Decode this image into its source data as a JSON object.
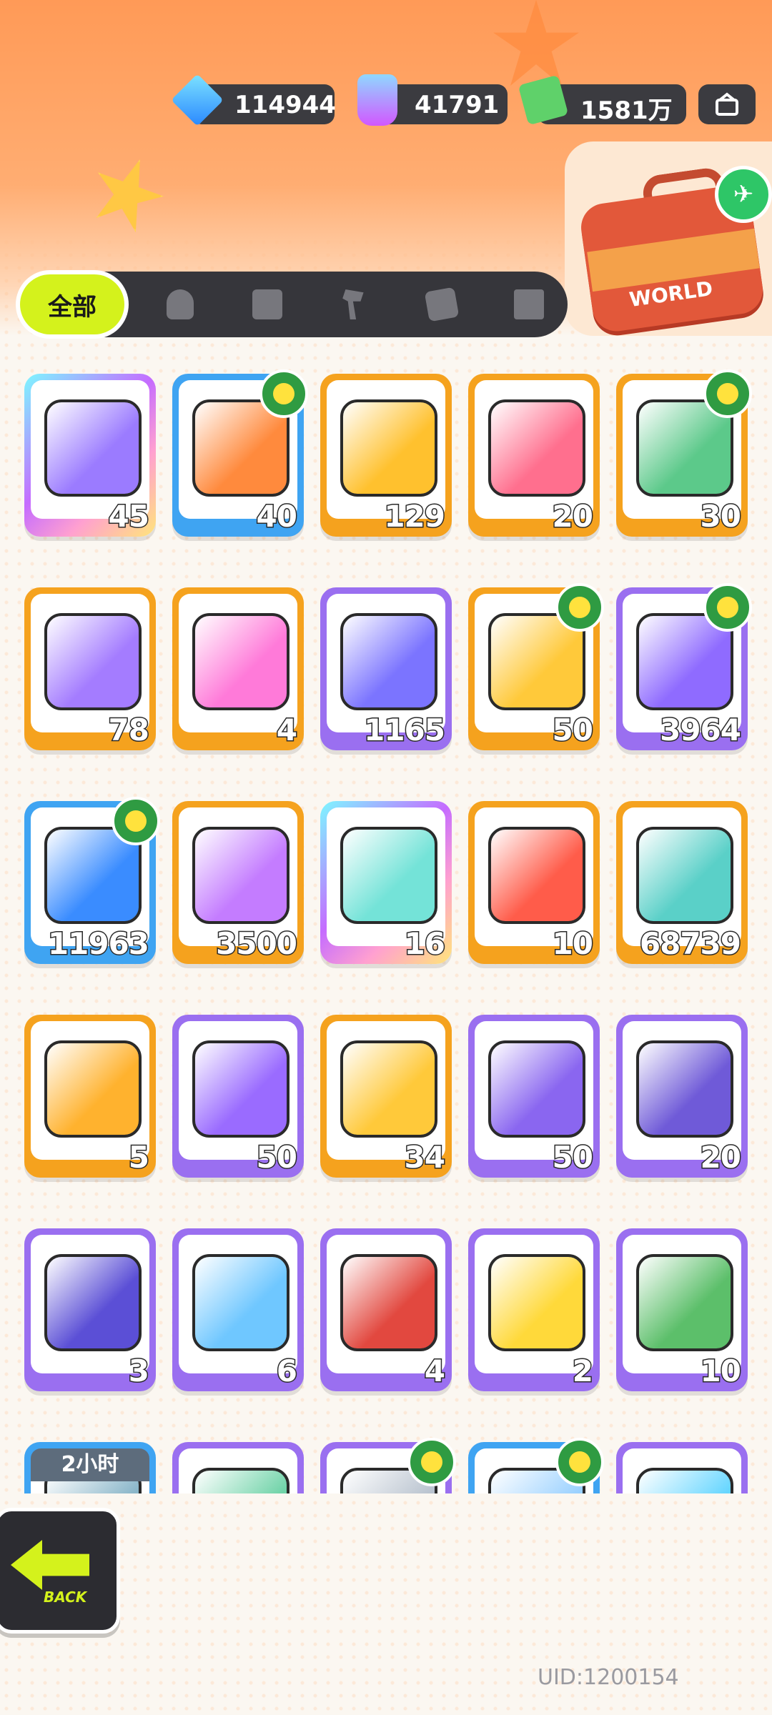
{
  "currencies": {
    "gems": "114944",
    "paint": "41791",
    "cash": "1581万"
  },
  "tabs": {
    "all_label": "全部",
    "icons": [
      "person-icon",
      "box-icon",
      "hammer-icon",
      "cards-icon",
      "book-icon"
    ]
  },
  "travel_bag_label": "WORLD",
  "colors": {
    "orange_frame": "#f5a21e",
    "purple_frame": "#9a6ff0",
    "blue_frame": "#3fa4f2",
    "tab_active": "#d4f21c"
  },
  "items": [
    {
      "count": "45",
      "frame": "rainbow",
      "icon": "ticket-icon",
      "color": "#9b7bff",
      "badge": false
    },
    {
      "count": "40",
      "frame": "blue",
      "icon": "lion-ticket-icon",
      "color": "#ff8a3d",
      "badge": true
    },
    {
      "count": "129",
      "frame": "orange",
      "icon": "gold-ticket-icon",
      "color": "#ffc12e",
      "badge": false
    },
    {
      "count": "20",
      "frame": "orange",
      "icon": "character-ticket-icon",
      "color": "#ff6f8e",
      "badge": false
    },
    {
      "count": "30",
      "frame": "orange",
      "icon": "dumpling-ticket-icon",
      "color": "#5cc98a",
      "badge": true
    },
    {
      "count": "78",
      "frame": "orange",
      "icon": "purple-ticket-icon",
      "color": "#a47cff",
      "badge": false
    },
    {
      "count": "4",
      "frame": "orange",
      "icon": "rainbow-star-icon",
      "color": "#ff7ad9",
      "badge": false
    },
    {
      "count": "1165",
      "frame": "purple",
      "icon": "purple-star-icon",
      "color": "#7b74ff",
      "badge": false
    },
    {
      "count": "50",
      "frame": "orange",
      "icon": "yellow-crayon-icon",
      "color": "#ffc93a",
      "badge": true
    },
    {
      "count": "3964",
      "frame": "purple",
      "icon": "purple-crayon-icon",
      "color": "#8f6bff",
      "badge": true
    },
    {
      "count": "11963",
      "frame": "blue",
      "icon": "blue-crayon-icon",
      "color": "#3a8cff",
      "badge": true
    },
    {
      "count": "3500",
      "frame": "orange",
      "icon": "cool-sticker-icon",
      "color": "#c47cff",
      "badge": false
    },
    {
      "count": "16",
      "frame": "rainbow",
      "icon": "lottery-ticket-icon",
      "color": "#74e3d8",
      "badge": false
    },
    {
      "count": "10",
      "frame": "orange",
      "icon": "star-badge-icon",
      "color": "#ff5c4a",
      "badge": false
    },
    {
      "count": "68739",
      "frame": "orange",
      "icon": "season-ticket-icon",
      "color": "#5ad0c8",
      "badge": false
    },
    {
      "count": "5",
      "frame": "orange",
      "icon": "gold-egg-icon",
      "color": "#ffb22e",
      "badge": false
    },
    {
      "count": "50",
      "frame": "purple",
      "icon": "purple-egg-icon",
      "color": "#9a6bff",
      "badge": false
    },
    {
      "count": "34",
      "frame": "orange",
      "icon": "gold-mystery-icon",
      "color": "#ffc93a",
      "badge": false
    },
    {
      "count": "50",
      "frame": "purple",
      "icon": "purple-mystery-icon",
      "color": "#8a66f0",
      "badge": false
    },
    {
      "count": "20",
      "frame": "purple",
      "icon": "travel-card-icon",
      "color": "#6f5ad8",
      "badge": false
    },
    {
      "count": "3",
      "frame": "purple",
      "icon": "cat-orb-icon",
      "color": "#5b4fd6",
      "badge": false
    },
    {
      "count": "6",
      "frame": "purple",
      "icon": "fish-orb-icon",
      "color": "#6fc7ff",
      "badge": false
    },
    {
      "count": "4",
      "frame": "purple",
      "icon": "piranha-orb-icon",
      "color": "#e2483f",
      "badge": false
    },
    {
      "count": "2",
      "frame": "purple",
      "icon": "jelly-orb-icon",
      "color": "#ffd93a",
      "badge": false
    },
    {
      "count": "10",
      "frame": "purple",
      "icon": "sprout-orb-icon",
      "color": "#5cbf6a",
      "badge": false
    },
    {
      "count": "",
      "frame": "blue",
      "icon": "item-icon",
      "color": "#8ab6c9",
      "badge": false,
      "timer": "2小时"
    },
    {
      "count": "",
      "frame": "purple",
      "icon": "item-icon",
      "color": "#6fd3a8",
      "badge": false
    },
    {
      "count": "",
      "frame": "purple",
      "icon": "item-icon",
      "color": "#b9c3cf",
      "badge": true
    },
    {
      "count": "",
      "frame": "blue",
      "icon": "item-icon",
      "color": "#9ad1ff",
      "badge": true
    },
    {
      "count": "",
      "frame": "purple",
      "icon": "item-icon",
      "color": "#66d6ff",
      "badge": false
    }
  ],
  "back_button_label": "BACK",
  "uid": "UID:1200154"
}
